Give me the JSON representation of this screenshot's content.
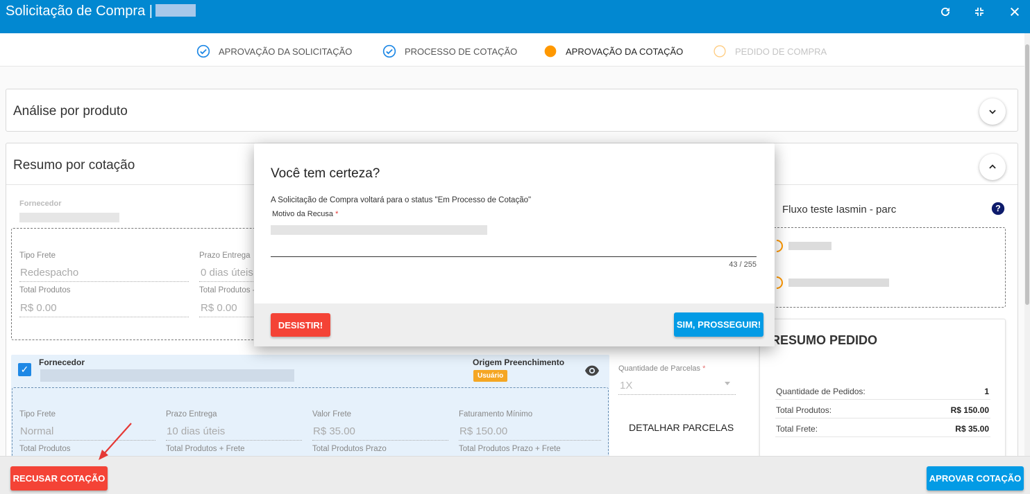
{
  "window": {
    "title": "Solicitação de Compra |"
  },
  "stepper": [
    {
      "label": "APROVAÇÃO DA SOLICITAÇÃO",
      "state": "done"
    },
    {
      "label": "PROCESSO DE COTAÇÃO",
      "state": "done"
    },
    {
      "label": "APROVAÇÃO DA COTAÇÃO",
      "state": "active"
    },
    {
      "label": "PEDIDO DE COMPRA",
      "state": "pending"
    }
  ],
  "panels": {
    "analise_title": "Análise por produto",
    "resumo_title": "Resumo por cotação"
  },
  "quote1": {
    "fornecedor_label": "Fornecedor",
    "tipo_frete_label": "Tipo Frete",
    "tipo_frete_value": "Redespacho",
    "prazo_entrega_label": "Prazo Entrega",
    "prazo_entrega_value": "0 dias úteis",
    "total_produtos_label": "Total Produtos",
    "total_produtos_value": "R$ 0.00",
    "total_produtos_frete_label": "Total Produtos -",
    "total_produtos_frete_value": "R$ 0.00"
  },
  "quote2": {
    "fornecedor_label": "Fornecedor",
    "origem_label": "Origem Preenchimento",
    "origem_badge": "Usuário",
    "tipo_frete_label": "Tipo Frete",
    "tipo_frete_value": "Normal",
    "prazo_entrega_label": "Prazo Entrega",
    "prazo_entrega_value": "10 dias úteis",
    "valor_frete_label": "Valor Frete",
    "valor_frete_value": "R$ 35.00",
    "faturamento_label": "Faturamento Mínimo",
    "faturamento_value": "R$ 150.00",
    "total_produtos_label": "Total Produtos",
    "total_produtos_frete_label": "Total Produtos + Frete",
    "total_produtos_prazo_label": "Total Produtos Prazo",
    "total_produtos_prazo_frete_label": "Total Produtos Prazo + Frete"
  },
  "parcelas": {
    "label": "Quantidade de Parcelas",
    "value": "1X",
    "detalhar_label": "DETALHAR PARCELAS"
  },
  "fluxo": {
    "title": "Fluxo teste Iasmin - parc"
  },
  "resumo_pedido": {
    "title": "RESUMO PEDIDO",
    "rows": [
      {
        "label": "Quantidade de Pedidos:",
        "value": "1"
      },
      {
        "label": "Total Produtos:",
        "value": "R$ 150.00"
      },
      {
        "label": "Total Frete:",
        "value": "R$ 35.00"
      }
    ]
  },
  "dialog": {
    "title": "Você tem certeza?",
    "message": "A Solicitação de Compra voltará para o status \"Em Processo de Cotação\"",
    "field_label": "Motivo da Recusa",
    "required_mark": "*",
    "counter": "43 / 255",
    "cancel_label": "DESISTIR!",
    "confirm_label": "SIM, PROSSEGUIR!"
  },
  "footer": {
    "reject_label": "RECUSAR COTAÇÃO",
    "approve_label": "APROVAR COTAÇÃO"
  },
  "colors": {
    "header": "#0288d1",
    "primary": "#039be5",
    "danger": "#f44336",
    "warning": "#f5a623",
    "step_active": "#ff9800",
    "selected_card": "#e6f1fb"
  },
  "icons": [
    "refresh-icon",
    "collapse-icon",
    "close-icon",
    "check-circle-icon",
    "dot-icon",
    "chevron-down-icon",
    "chevron-up-icon",
    "help-icon",
    "eye-icon",
    "checkbox-icon",
    "arrow-icon"
  ]
}
